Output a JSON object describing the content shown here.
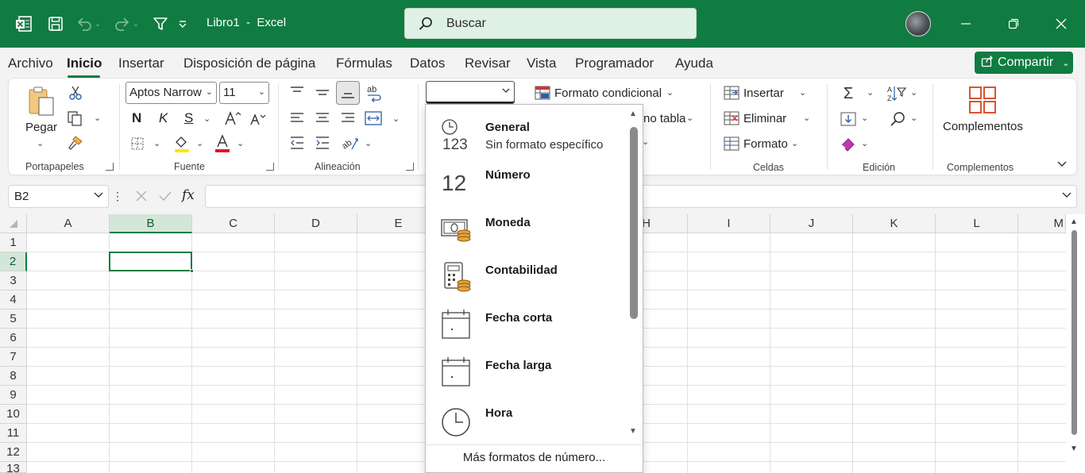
{
  "titlebar": {
    "title": "Libro1  -  Excel",
    "search_placeholder": "Buscar",
    "window_buttons": [
      "minimize",
      "restore",
      "close"
    ]
  },
  "menu": {
    "tabs": [
      "Archivo",
      "Inicio",
      "Insertar",
      "Disposición de página",
      "Fórmulas",
      "Datos",
      "Revisar",
      "Vista",
      "Programador",
      "Ayuda"
    ],
    "active_tab": "Inicio",
    "share_label": "Compartir"
  },
  "ribbon": {
    "portapapeles": {
      "paste_label": "Pegar",
      "group_label": "Portapapeles"
    },
    "fuente": {
      "font_name": "Aptos Narrow",
      "font_size": "11",
      "bold": "N",
      "italic": "K",
      "underline": "S",
      "group_label": "Fuente"
    },
    "alineacion": {
      "group_label": "Alineación"
    },
    "estilos": {
      "conditional_format": "Formato condicional",
      "table_format_fragment": "no tabla"
    },
    "celdas": {
      "insert": "Insertar",
      "delete": "Eliminar",
      "format": "Formato",
      "group_label": "Celdas"
    },
    "edicion": {
      "group_label": "Edición"
    },
    "complementos": {
      "button_label": "Complementos",
      "group_label": "Complementos"
    }
  },
  "formula_bar": {
    "name_box": "B2",
    "fx": "fx",
    "formula": ""
  },
  "grid": {
    "columns": [
      "A",
      "B",
      "C",
      "D",
      "E",
      "H",
      "I",
      "J",
      "K",
      "L",
      "M"
    ],
    "rows": [
      "1",
      "2",
      "3",
      "4",
      "5",
      "6",
      "7",
      "8",
      "9",
      "10",
      "11",
      "12",
      "13"
    ],
    "selected_cell": "B2",
    "selected_column": "B",
    "selected_row": "2"
  },
  "number_format": {
    "current_value": "",
    "items": [
      {
        "title": "General",
        "subtitle": "Sin formato específico",
        "icon": "clock-123-icon"
      },
      {
        "title": "Número",
        "subtitle": "",
        "icon": "number-12-icon"
      },
      {
        "title": "Moneda",
        "subtitle": "",
        "icon": "currency-icon"
      },
      {
        "title": "Contabilidad",
        "subtitle": "",
        "icon": "accounting-icon"
      },
      {
        "title": "Fecha corta",
        "subtitle": "",
        "icon": "calendar-icon"
      },
      {
        "title": "Fecha larga",
        "subtitle": "",
        "icon": "calendar-icon"
      },
      {
        "title": "Hora",
        "subtitle": "",
        "icon": "clock-icon"
      }
    ],
    "more_label": "Más formatos de número..."
  },
  "colors": {
    "brand": "#107c41",
    "search_bg": "#dff0e4",
    "coin": "#e8a33a"
  }
}
